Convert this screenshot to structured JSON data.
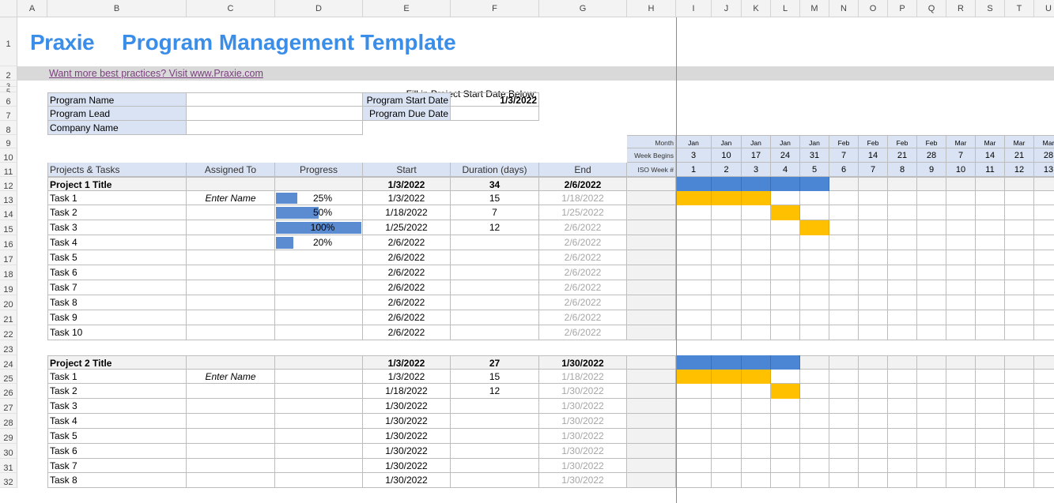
{
  "columns": [
    "A",
    "B",
    "C",
    "D",
    "E",
    "F",
    "G",
    "H",
    "I",
    "J",
    "K",
    "L",
    "M",
    "N",
    "O",
    "P",
    "Q",
    "R",
    "S",
    "T",
    "U"
  ],
  "rows": [
    "1",
    "2",
    "3",
    "5",
    "6",
    "7",
    "8",
    "9",
    "10",
    "11",
    "12",
    "13",
    "14",
    "15",
    "16",
    "17",
    "18",
    "19",
    "20",
    "21",
    "22",
    "23",
    "24",
    "25",
    "26",
    "27",
    "28",
    "29",
    "30",
    "31",
    "32"
  ],
  "logo": "Praxie",
  "title": "Program Management Template",
  "link": "Want more best practices? Visit www.Praxie.com",
  "fill_note": "Fill in Project Start Date Below:",
  "info_labels": [
    "Program Name",
    "Program Lead",
    "Company Name"
  ],
  "start_label": "Program Start Date",
  "start_value": "1/3/2022",
  "due_label": "Program Due Date",
  "headers": [
    "Projects & Tasks",
    "Assigned To",
    "Progress",
    "Start",
    "Duration (days)",
    "End"
  ],
  "gantt_labels": [
    "Month",
    "Week Begins",
    "ISO Week #"
  ],
  "months": [
    "Jan",
    "Jan",
    "Jan",
    "Jan",
    "Jan",
    "Feb",
    "Feb",
    "Feb",
    "Feb",
    "Mar",
    "Mar",
    "Mar",
    "Mar"
  ],
  "weeks": [
    "3",
    "10",
    "17",
    "24",
    "31",
    "7",
    "14",
    "21",
    "28",
    "7",
    "14",
    "21",
    "28"
  ],
  "iso": [
    "1",
    "2",
    "3",
    "4",
    "5",
    "6",
    "7",
    "8",
    "9",
    "10",
    "11",
    "12",
    "13"
  ],
  "project1": {
    "title": "Project 1 Title",
    "start": "1/3/2022",
    "duration": "34",
    "end": "2/6/2022",
    "tasks": [
      {
        "name": "Task 1",
        "assigned": "Enter Name",
        "progress": "25%",
        "pct": 0.25,
        "start": "1/3/2022",
        "duration": "15",
        "end": "1/18/2022"
      },
      {
        "name": "Task 2",
        "assigned": "",
        "progress": "50%",
        "pct": 0.5,
        "start": "1/18/2022",
        "duration": "7",
        "end": "1/25/2022"
      },
      {
        "name": "Task 3",
        "assigned": "",
        "progress": "100%",
        "pct": 1.0,
        "start": "1/25/2022",
        "duration": "12",
        "end": "2/6/2022"
      },
      {
        "name": "Task 4",
        "assigned": "",
        "progress": "20%",
        "pct": 0.2,
        "start": "2/6/2022",
        "duration": "",
        "end": "2/6/2022"
      },
      {
        "name": "Task 5",
        "assigned": "",
        "progress": "",
        "pct": 0,
        "start": "2/6/2022",
        "duration": "",
        "end": "2/6/2022"
      },
      {
        "name": "Task 6",
        "assigned": "",
        "progress": "",
        "pct": 0,
        "start": "2/6/2022",
        "duration": "",
        "end": "2/6/2022"
      },
      {
        "name": "Task 7",
        "assigned": "",
        "progress": "",
        "pct": 0,
        "start": "2/6/2022",
        "duration": "",
        "end": "2/6/2022"
      },
      {
        "name": "Task 8",
        "assigned": "",
        "progress": "",
        "pct": 0,
        "start": "2/6/2022",
        "duration": "",
        "end": "2/6/2022"
      },
      {
        "name": "Task 9",
        "assigned": "",
        "progress": "",
        "pct": 0,
        "start": "2/6/2022",
        "duration": "",
        "end": "2/6/2022"
      },
      {
        "name": "Task 10",
        "assigned": "",
        "progress": "",
        "pct": 0,
        "start": "2/6/2022",
        "duration": "",
        "end": "2/6/2022"
      }
    ]
  },
  "project2": {
    "title": "Project 2 Title",
    "start": "1/3/2022",
    "duration": "27",
    "end": "1/30/2022",
    "tasks": [
      {
        "name": "Task 1",
        "assigned": "Enter Name",
        "progress": "",
        "pct": 0,
        "start": "1/3/2022",
        "duration": "15",
        "end": "1/18/2022"
      },
      {
        "name": "Task 2",
        "assigned": "",
        "progress": "",
        "pct": 0,
        "start": "1/18/2022",
        "duration": "12",
        "end": "1/30/2022"
      },
      {
        "name": "Task 3",
        "assigned": "",
        "progress": "",
        "pct": 0,
        "start": "1/30/2022",
        "duration": "",
        "end": "1/30/2022"
      },
      {
        "name": "Task 4",
        "assigned": "",
        "progress": "",
        "pct": 0,
        "start": "1/30/2022",
        "duration": "",
        "end": "1/30/2022"
      },
      {
        "name": "Task 5",
        "assigned": "",
        "progress": "",
        "pct": 0,
        "start": "1/30/2022",
        "duration": "",
        "end": "1/30/2022"
      },
      {
        "name": "Task 6",
        "assigned": "",
        "progress": "",
        "pct": 0,
        "start": "1/30/2022",
        "duration": "",
        "end": "1/30/2022"
      },
      {
        "name": "Task 7",
        "assigned": "",
        "progress": "",
        "pct": 0,
        "start": "1/30/2022",
        "duration": "",
        "end": "1/30/2022"
      },
      {
        "name": "Task 8",
        "assigned": "",
        "progress": "",
        "pct": 0,
        "start": "1/30/2022",
        "duration": "",
        "end": "1/30/2022"
      }
    ]
  },
  "colors": {
    "brand": "#3b8ee8",
    "label_bg": "#dae3f3",
    "gantt_project": "#4a86d4",
    "gantt_task": "#ffc000",
    "progress_bar": "#5b8bd0",
    "link": "#7b3f7f",
    "grey_band": "#d9d9d9"
  }
}
